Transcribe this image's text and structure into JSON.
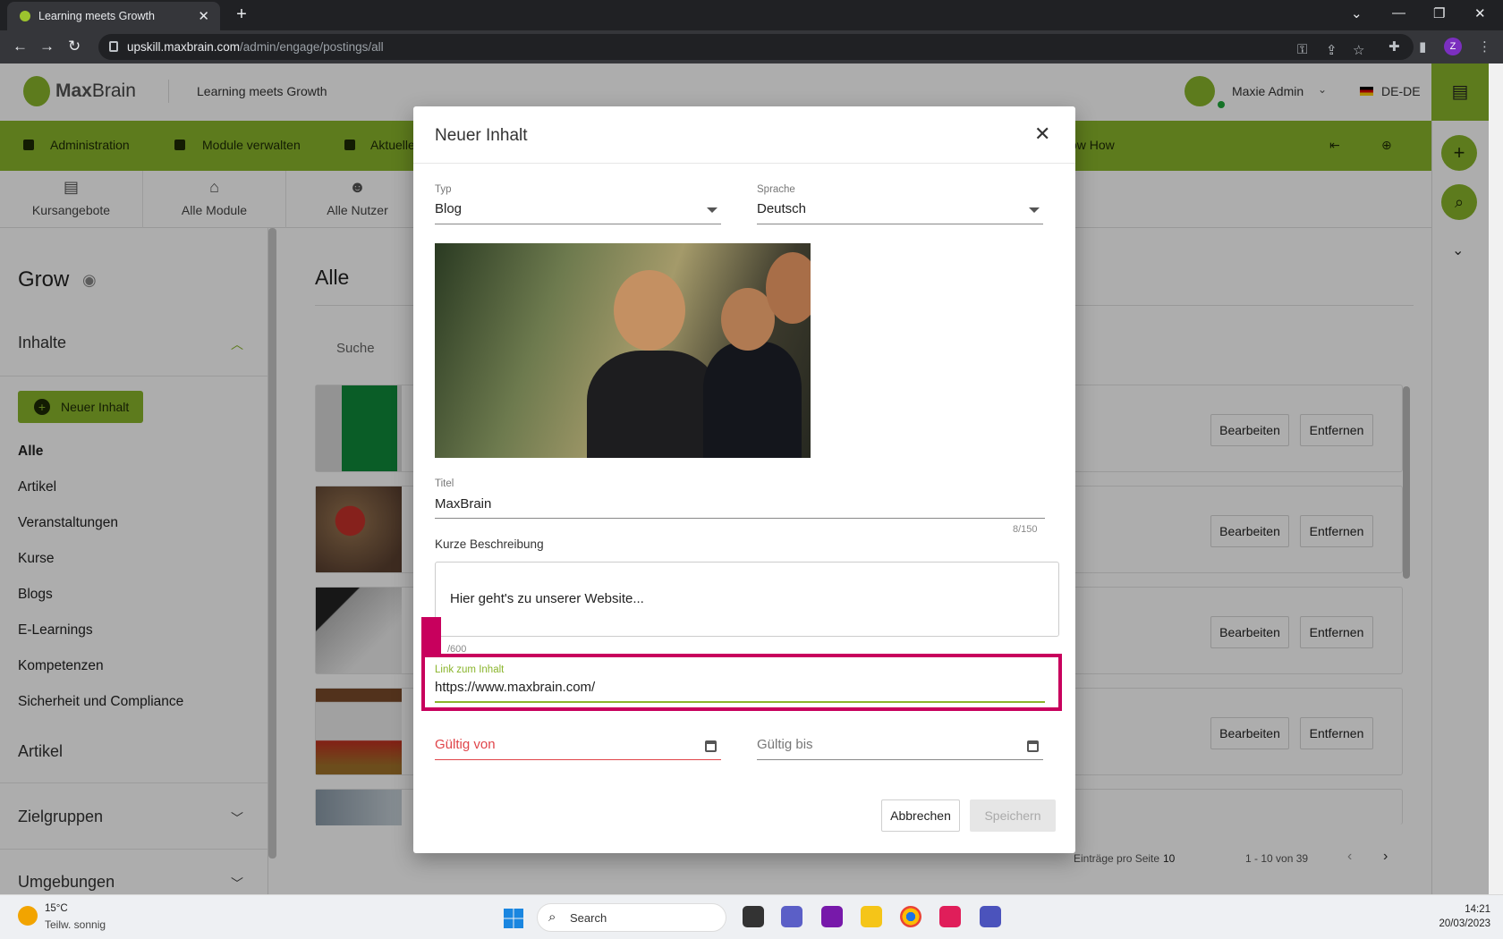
{
  "browser": {
    "tab_title": "Learning meets Growth",
    "url_host": "upskill.maxbrain.com",
    "url_path": "/admin/engage/postings/all",
    "profile_initial": "Z"
  },
  "header": {
    "logo_max": "Max",
    "logo_brain": "Brain",
    "tagline": "Learning meets Growth",
    "user_name": "Maxie Admin",
    "language": "DE-DE"
  },
  "green_nav": {
    "items": [
      "Administration",
      "Module verwalten",
      "Aktuelle",
      "ow How"
    ]
  },
  "module_tabs": [
    "Kursangebote",
    "Alle Module",
    "Alle Nutzer"
  ],
  "sidebar": {
    "title": "Grow",
    "section_inhalte": "Inhalte",
    "new_button": "Neuer Inhalt",
    "links": [
      "Alle",
      "Artikel",
      "Veranstaltungen",
      "Kurse",
      "Blogs",
      "E-Learnings",
      "Kompetenzen",
      "Sicherheit und Compliance"
    ],
    "section_artikel": "Artikel",
    "section_zielgruppen": "Zielgruppen",
    "section_umgebungen": "Umgebungen"
  },
  "main": {
    "title": "Alle",
    "search_placeholder": "Suche",
    "edit_label": "Bearbeiten",
    "remove_label": "Entfernen",
    "per_page_label": "Einträge pro Seite",
    "per_page_value": "10",
    "range": "1 - 10 von 39"
  },
  "modal": {
    "title": "Neuer Inhalt",
    "type_label": "Typ",
    "type_value": "Blog",
    "language_label": "Sprache",
    "language_value": "Deutsch",
    "title_label": "Titel",
    "title_value": "MaxBrain",
    "title_counter": "8/150",
    "desc_label": "Kurze Beschreibung",
    "desc_value": "Hier geht's zu unserer Website...",
    "desc_counter": "/600",
    "link_label": "Link zum Inhalt",
    "link_value": "https://www.maxbrain.com/",
    "valid_from": "Gültig von",
    "valid_to": "Gültig bis",
    "cancel": "Abbrechen",
    "save": "Speichern"
  },
  "taskbar": {
    "temperature": "15°C",
    "weather": "Teilw. sonnig",
    "search": "Search",
    "time": "14:21",
    "date": "20/03/2023"
  },
  "colors": {
    "brand_green": "#8ab52c",
    "highlight": "#c8005d",
    "error_red": "#e0454a"
  }
}
